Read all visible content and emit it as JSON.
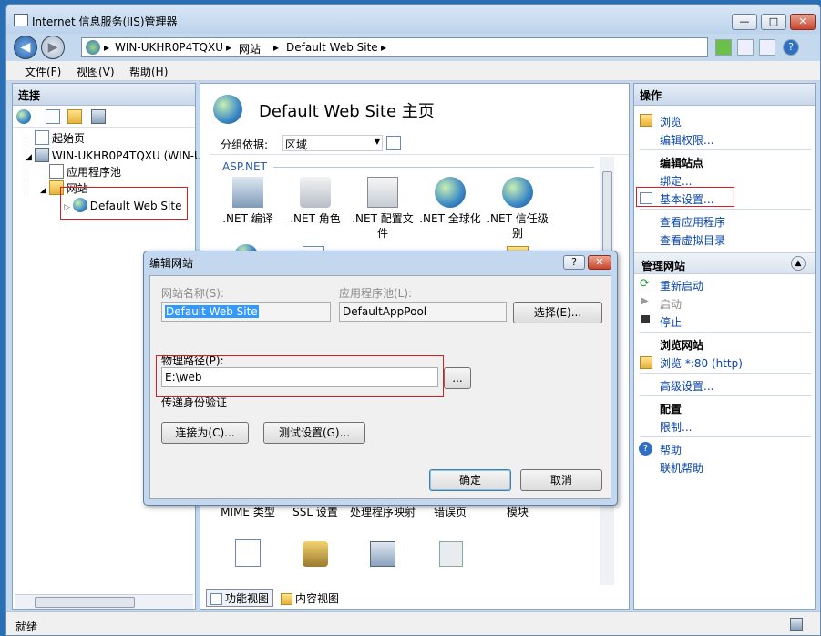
{
  "window": {
    "title": "Internet 信息服务(IIS)管理器",
    "minimize": "—",
    "maximize": "□",
    "close": "✕"
  },
  "nav": {
    "back": "◀",
    "forward": "▶",
    "breadcrumb": [
      "WIN-UKHR0P4TQXU",
      "网站",
      "Default Web Site"
    ],
    "sep": "▸"
  },
  "menu": [
    "文件(F)",
    "视图(V)",
    "帮助(H)"
  ],
  "connections": {
    "title": "连接",
    "tree": [
      "起始页",
      "WIN-UKHR0P4TQXU (WIN-UK",
      "应用程序池",
      "网站",
      "Default Web Site"
    ]
  },
  "center": {
    "title": "Default Web Site 主页",
    "group_label": "分组依据:",
    "group_value": "区域",
    "section": "ASP.NET",
    "features": [
      ".NET 编译",
      ".NET 角色",
      ".NET 配置文件",
      ".NET 全球化",
      ".NET 信任级别"
    ],
    "features_bottom": [
      "MIME 类型",
      "SSL 设置",
      "处理程序映射",
      "错误页",
      "模块"
    ],
    "tabs": [
      "功能视图",
      "内容视图"
    ]
  },
  "actions": {
    "title": "操作",
    "browse": "浏览",
    "edit_perms": "编辑权限...",
    "edit_site": "编辑站点",
    "bindings": "绑定...",
    "basic_settings": "基本设置...",
    "view_apps": "查看应用程序",
    "view_vdirs": "查看虚拟目录",
    "manage_site": "管理网站",
    "restart": "重新启动",
    "start": "启动",
    "stop": "停止",
    "browse_site": "浏览网站",
    "browse_80": "浏览 *:80 (http)",
    "advanced": "高级设置...",
    "config": "配置",
    "limits": "限制...",
    "help": "帮助",
    "online_help": "联机帮助"
  },
  "dialog": {
    "title": "编辑网站",
    "help_btn": "?",
    "close_btn": "✕",
    "site_name_label": "网站名称(S):",
    "site_name_value": "Default Web Site",
    "pool_label": "应用程序池(L):",
    "pool_value": "DefaultAppPool",
    "select_btn": "选择(E)...",
    "path_label": "物理路径(P):",
    "path_value": "E:\\web",
    "browse_btn": "...",
    "auth_label": "传递身份验证",
    "connect_as_btn": "连接为(C)...",
    "test_btn": "测试设置(G)...",
    "ok_btn": "确定",
    "cancel_btn": "取消"
  },
  "status": {
    "text": "就绪"
  }
}
